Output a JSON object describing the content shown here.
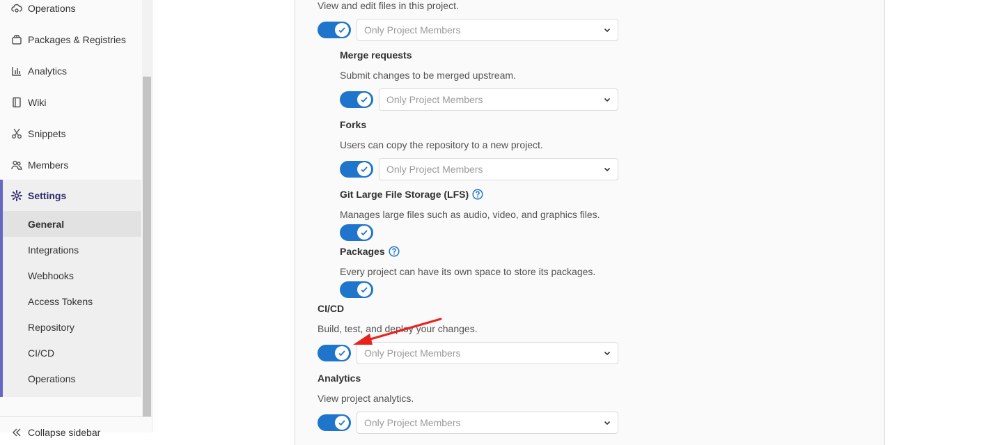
{
  "sidebar": {
    "items": [
      {
        "label": "Operations",
        "icon": "cloud-gear-icon"
      },
      {
        "label": "Packages & Registries",
        "icon": "package-icon"
      },
      {
        "label": "Analytics",
        "icon": "chart-icon"
      },
      {
        "label": "Wiki",
        "icon": "book-icon"
      },
      {
        "label": "Snippets",
        "icon": "scissors-icon"
      },
      {
        "label": "Members",
        "icon": "users-icon"
      }
    ],
    "settings": {
      "label": "Settings",
      "icon": "gear-icon",
      "subitems": [
        "General",
        "Integrations",
        "Webhooks",
        "Access Tokens",
        "Repository",
        "CI/CD",
        "Operations"
      ],
      "active": "General"
    },
    "collapse_label": "Collapse sidebar"
  },
  "features": {
    "repository": {
      "desc": "View and edit files in this project.",
      "select": "Only Project Members"
    },
    "merge_requests": {
      "label": "Merge requests",
      "desc": "Submit changes to be merged upstream.",
      "select": "Only Project Members"
    },
    "forks": {
      "label": "Forks",
      "desc": "Users can copy the repository to a new project.",
      "select": "Only Project Members"
    },
    "lfs": {
      "label": "Git Large File Storage (LFS)",
      "desc": "Manages large files such as audio, video, and graphics files."
    },
    "packages": {
      "label": "Packages",
      "desc": "Every project can have its own space to store its packages."
    },
    "cicd": {
      "label": "CI/CD",
      "desc": "Build, test, and deploy your changes.",
      "select": "Only Project Members"
    },
    "analytics": {
      "label": "Analytics",
      "desc": "View project analytics.",
      "select": "Only Project Members"
    }
  },
  "colors": {
    "accent": "#1f75cb",
    "settings_border": "#6666c4",
    "annotation_arrow": "#e8231c"
  }
}
